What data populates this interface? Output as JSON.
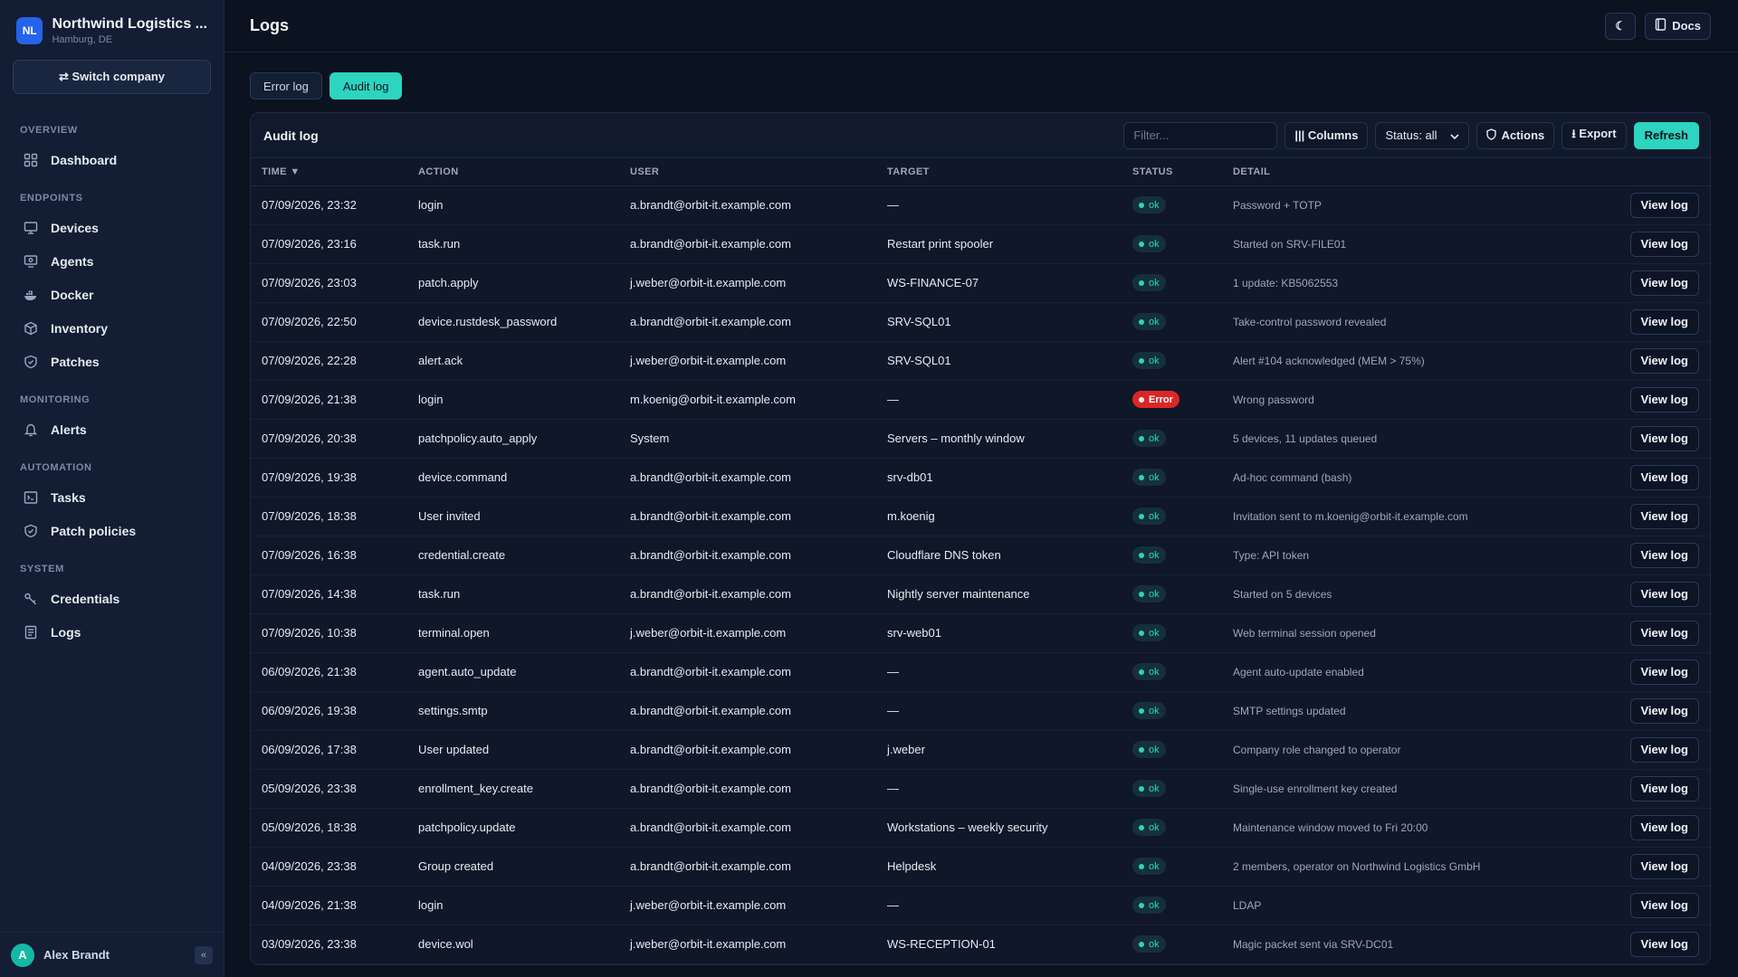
{
  "org": {
    "initials": "NL",
    "name": "Northwind Logistics ...",
    "location": "Hamburg, DE"
  },
  "switch_company": "⇄ Switch company",
  "nav": {
    "sections": [
      {
        "title": "OVERVIEW",
        "items": [
          {
            "label": "Dashboard",
            "icon": "dashboard-icon"
          }
        ]
      },
      {
        "title": "ENDPOINTS",
        "items": [
          {
            "label": "Devices",
            "icon": "monitor-icon"
          },
          {
            "label": "Agents",
            "icon": "agent-icon"
          },
          {
            "label": "Docker",
            "icon": "docker-icon"
          },
          {
            "label": "Inventory",
            "icon": "box-icon"
          },
          {
            "label": "Patches",
            "icon": "shield-icon"
          }
        ]
      },
      {
        "title": "MONITORING",
        "items": [
          {
            "label": "Alerts",
            "icon": "bell-icon"
          }
        ]
      },
      {
        "title": "AUTOMATION",
        "items": [
          {
            "label": "Tasks",
            "icon": "terminal-icon"
          },
          {
            "label": "Patch policies",
            "icon": "shield-check-icon"
          }
        ]
      },
      {
        "title": "SYSTEM",
        "items": [
          {
            "label": "Credentials",
            "icon": "key-icon"
          },
          {
            "label": "Logs",
            "icon": "log-icon"
          }
        ]
      }
    ]
  },
  "user": {
    "initial": "A",
    "name": "Alex Brandt",
    "collapse": "«"
  },
  "page": {
    "title": "Logs",
    "theme_icon": "☾",
    "docs": "Docs"
  },
  "tabs": [
    {
      "label": "Error log",
      "active": false
    },
    {
      "label": "Audit log",
      "active": true
    }
  ],
  "panel": {
    "title": "Audit log",
    "filter_placeholder": "Filter...",
    "columns_label": "||| Columns",
    "status_select": "Status: all",
    "actions_label": "Actions",
    "export_label": "⭳ Export",
    "refresh_label": "Refresh"
  },
  "table": {
    "headers": {
      "time": "TIME ▼",
      "action": "ACTION",
      "user": "USER",
      "target": "TARGET",
      "status": "STATUS",
      "detail": "DETAIL"
    },
    "view_label": "View log",
    "rows": [
      {
        "time": "07/09/2026, 23:32",
        "action": "login",
        "user": "a.brandt@orbit-it.example.com",
        "target": "—",
        "status": "ok",
        "detail": "Password + TOTP"
      },
      {
        "time": "07/09/2026, 23:16",
        "action": "task.run",
        "user": "a.brandt@orbit-it.example.com",
        "target": "Restart print spooler",
        "status": "ok",
        "detail": "Started on SRV-FILE01"
      },
      {
        "time": "07/09/2026, 23:03",
        "action": "patch.apply",
        "user": "j.weber@orbit-it.example.com",
        "target": "WS-FINANCE-07",
        "status": "ok",
        "detail": "1 update: KB5062553"
      },
      {
        "time": "07/09/2026, 22:50",
        "action": "device.rustdesk_password",
        "user": "a.brandt@orbit-it.example.com",
        "target": "SRV-SQL01",
        "status": "ok",
        "detail": "Take-control password revealed"
      },
      {
        "time": "07/09/2026, 22:28",
        "action": "alert.ack",
        "user": "j.weber@orbit-it.example.com",
        "target": "SRV-SQL01",
        "status": "ok",
        "detail": "Alert #104 acknowledged (MEM > 75%)"
      },
      {
        "time": "07/09/2026, 21:38",
        "action": "login",
        "user": "m.koenig@orbit-it.example.com",
        "target": "—",
        "status": "Error",
        "detail": "Wrong password"
      },
      {
        "time": "07/09/2026, 20:38",
        "action": "patchpolicy.auto_apply",
        "user": "System",
        "target": "Servers – monthly window",
        "status": "ok",
        "detail": "5 devices, 11 updates queued"
      },
      {
        "time": "07/09/2026, 19:38",
        "action": "device.command",
        "user": "a.brandt@orbit-it.example.com",
        "target": "srv-db01",
        "status": "ok",
        "detail": "Ad-hoc command (bash)"
      },
      {
        "time": "07/09/2026, 18:38",
        "action": "User invited",
        "user": "a.brandt@orbit-it.example.com",
        "target": "m.koenig",
        "status": "ok",
        "detail": "Invitation sent to m.koenig@orbit-it.example.com"
      },
      {
        "time": "07/09/2026, 16:38",
        "action": "credential.create",
        "user": "a.brandt@orbit-it.example.com",
        "target": "Cloudflare DNS token",
        "status": "ok",
        "detail": "Type: API token"
      },
      {
        "time": "07/09/2026, 14:38",
        "action": "task.run",
        "user": "a.brandt@orbit-it.example.com",
        "target": "Nightly server maintenance",
        "status": "ok",
        "detail": "Started on 5 devices"
      },
      {
        "time": "07/09/2026, 10:38",
        "action": "terminal.open",
        "user": "j.weber@orbit-it.example.com",
        "target": "srv-web01",
        "status": "ok",
        "detail": "Web terminal session opened"
      },
      {
        "time": "06/09/2026, 21:38",
        "action": "agent.auto_update",
        "user": "a.brandt@orbit-it.example.com",
        "target": "—",
        "status": "ok",
        "detail": "Agent auto-update enabled"
      },
      {
        "time": "06/09/2026, 19:38",
        "action": "settings.smtp",
        "user": "a.brandt@orbit-it.example.com",
        "target": "—",
        "status": "ok",
        "detail": "SMTP settings updated"
      },
      {
        "time": "06/09/2026, 17:38",
        "action": "User updated",
        "user": "a.brandt@orbit-it.example.com",
        "target": "j.weber",
        "status": "ok",
        "detail": "Company role changed to operator"
      },
      {
        "time": "05/09/2026, 23:38",
        "action": "enrollment_key.create",
        "user": "a.brandt@orbit-it.example.com",
        "target": "—",
        "status": "ok",
        "detail": "Single-use enrollment key created"
      },
      {
        "time": "05/09/2026, 18:38",
        "action": "patchpolicy.update",
        "user": "a.brandt@orbit-it.example.com",
        "target": "Workstations – weekly security",
        "status": "ok",
        "detail": "Maintenance window moved to Fri 20:00"
      },
      {
        "time": "04/09/2026, 23:38",
        "action": "Group created",
        "user": "a.brandt@orbit-it.example.com",
        "target": "Helpdesk",
        "status": "ok",
        "detail": "2 members, operator on Northwind Logistics GmbH"
      },
      {
        "time": "04/09/2026, 21:38",
        "action": "login",
        "user": "j.weber@orbit-it.example.com",
        "target": "—",
        "status": "ok",
        "detail": "LDAP"
      },
      {
        "time": "03/09/2026, 23:38",
        "action": "device.wol",
        "user": "j.weber@orbit-it.example.com",
        "target": "WS-RECEPTION-01",
        "status": "ok",
        "detail": "Magic packet sent via SRV-DC01"
      }
    ]
  }
}
